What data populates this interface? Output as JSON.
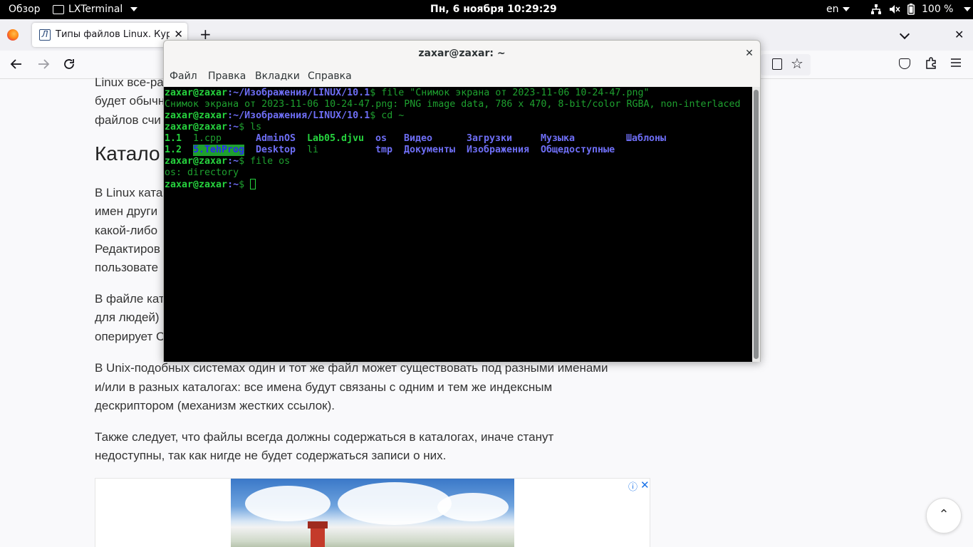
{
  "topbar": {
    "overview": "Обзор",
    "app_name": "LXTerminal",
    "clock": "Пн, 6 ноября  10:29:29",
    "lang": "en",
    "battery": "100 %"
  },
  "browser": {
    "tab_title": "Типы файлов Linux. Курс",
    "tab_favicon": "Л",
    "new_tab": "+",
    "close_window": "✕",
    "tab_close": "✕"
  },
  "article": {
    "p1_line1": "Linux все-ра",
    "p1_line2": "будет обычн",
    "p1_line3": "файлов счи",
    "heading": "Катало",
    "p2_line1": "В Linux ката",
    "p2_line2": "имен други",
    "p2_line3": "какой-либо",
    "p2_line4": "Редактиров",
    "p2_line5": "пользовате",
    "p3_line1": "В файле кат",
    "p3_line2": "для людей)",
    "p3_line3": "оперирует С",
    "p4_line1": "В Unix-подобных системах один и тот же файл может существовать под разными именами",
    "p4_line2": "и/или в разных каталогах: все имена будут связаны с одним и тем же индексным",
    "p4_line3": "дескриптором (механизм жестких ссылок).",
    "p5_line1": "Также следует, что файлы всегда должны содержаться в каталогах, иначе станут",
    "p5_line2": "недоступны, так как нигде не будет содержаться записи о них.",
    "ad_info": "ⓘ",
    "ad_close": "✕",
    "scroll_top": "⌃"
  },
  "terminal": {
    "title": "zaxar@zaxar: ~",
    "close": "✕",
    "menu": [
      "Файл",
      "Правка",
      "Вкладки",
      "Справка"
    ],
    "prompt_user": "zaxar@zaxar",
    "path1": ":~/Изображения/LINUX/10.1",
    "cmd1": "$ file \"Снимок экрана от 2023-11-06 10-24-47.png\"",
    "out1": "Снимок экрана от 2023-11-06 10-24-47.png: PNG image data, 786 x 470, 8-bit/color RGBA, non-interlaced",
    "cmd2": "$ cd ~",
    "home": ":~",
    "cmd3": "$ ls",
    "ls_row1": [
      "1.1",
      "1.cpp",
      "AdminOS",
      "Lab05.djvu",
      "os",
      "Видео",
      "Загрузки",
      "Музыка",
      "Шаблоны"
    ],
    "ls_row2": [
      "1.2",
      "5.TehProg",
      "Desktop",
      "li",
      "tmp",
      "Документы",
      "Изображения",
      "Общедоступные"
    ],
    "cmd4": "$ file os",
    "out4": "os: directory",
    "cmd5": "$ "
  }
}
